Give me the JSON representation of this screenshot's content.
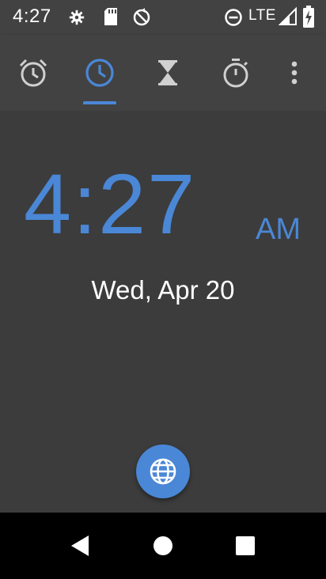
{
  "status_bar": {
    "time": "4:27",
    "network": "LTE",
    "icons": [
      "settings-gear-icon",
      "sd-card-icon",
      "sync-disabled-icon",
      "do-not-disturb-icon",
      "signal-icon",
      "battery-charging-icon"
    ]
  },
  "tabs": [
    {
      "name": "alarm-icon",
      "selected": false
    },
    {
      "name": "clock-icon",
      "selected": true
    },
    {
      "name": "timer-icon",
      "selected": false
    },
    {
      "name": "stopwatch-icon",
      "selected": false
    }
  ],
  "clock": {
    "time": "4:27",
    "ampm": "AM",
    "date": "Wed, Apr 20"
  },
  "fab": {
    "icon": "globe-icon"
  },
  "nav": {
    "back": "back-icon",
    "home": "home-icon",
    "recents": "recents-icon"
  },
  "colors": {
    "accent": "#4a87d6",
    "background": "#3c3c3c",
    "toolbar": "#424242"
  }
}
